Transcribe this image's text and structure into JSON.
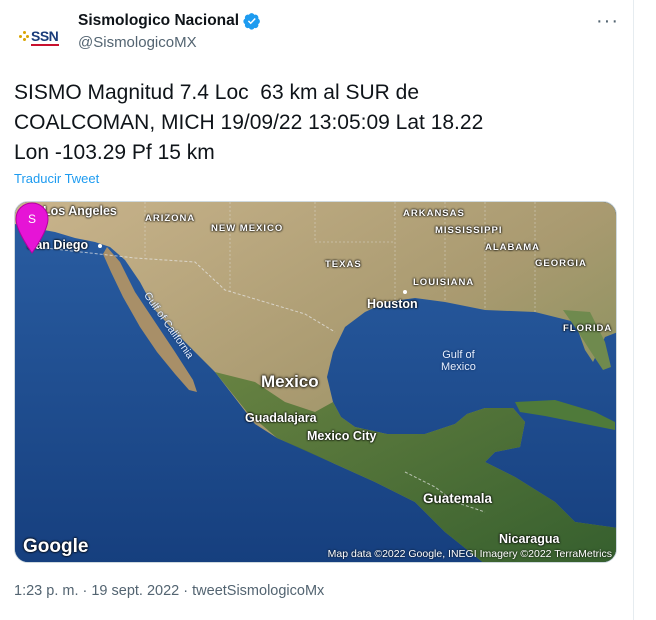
{
  "author": {
    "display_name": "Sismologico Nacional",
    "handle": "@SismologicoMX",
    "avatar_text": "SSN",
    "verified_icon": "verified-badge-icon",
    "verified_color": "#1d9bf0"
  },
  "more_label": "···",
  "tweet": {
    "text": "SISMO Magnitud 7.4 Loc  63 km al SUR de\nCOALCOMAN, MICH 19/09/22 13:05:09 Lat 18.22\nLon -103.29 Pf 15 km",
    "translate_label": "Traducir Tweet"
  },
  "map": {
    "marker_letter": "S",
    "marker_color": "#e614d6",
    "labels": {
      "los_angeles": "Los Angeles",
      "san_diego": "San Diego",
      "arizona": "ARIZONA",
      "new_mexico": "NEW MEXICO",
      "texas": "TEXAS",
      "arkansas": "ARKANSAS",
      "mississippi": "MISSISSIPPI",
      "alabama": "ALABAMA",
      "georgia": "GEORGIA",
      "louisiana": "LOUISIANA",
      "houston": "Houston",
      "florida": "FLORIDA",
      "gulf_of_california": "Gulf of California",
      "gulf_of_mexico": "Gulf of\nMexico",
      "mexico": "Mexico",
      "guadalajara": "Guadalajara",
      "mexico_city": "Mexico City",
      "guatemala": "Guatemala",
      "nicaragua": "Nicaragua"
    },
    "google_logo": "Google",
    "attribution": "Map data ©2022 Google, INEGI Imagery ©2022 TerraMetrics"
  },
  "meta": {
    "time": "1:23 p. m.",
    "separator": "·",
    "date": "19 sept. 2022",
    "source": "tweetSismologicoMx",
    "full": "1:23 p. m. · 19 sept. 2022 · tweetSismologicoMx"
  }
}
